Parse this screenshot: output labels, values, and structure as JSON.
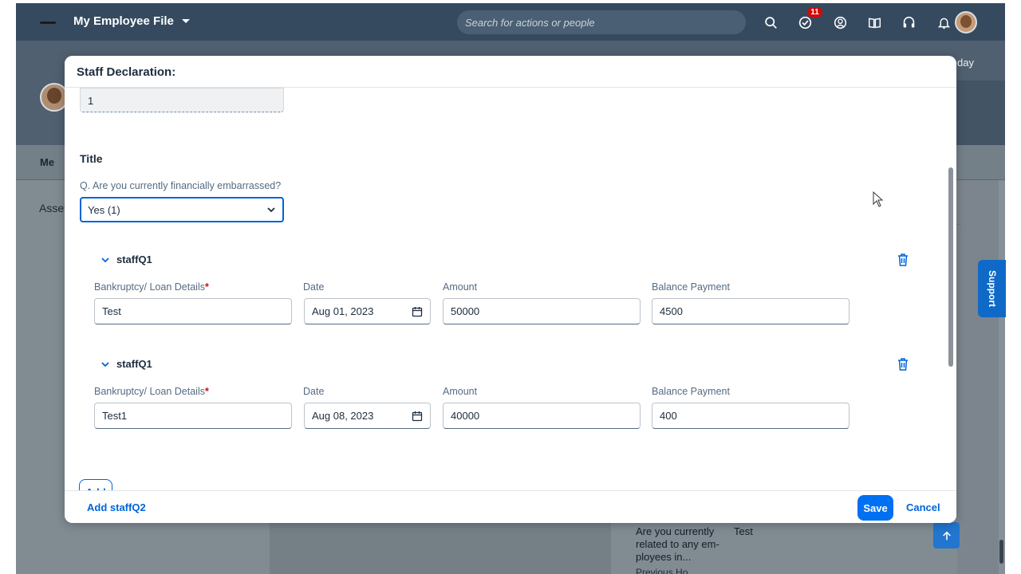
{
  "shell": {
    "title": "My Employee File",
    "search_placeholder": "Search for actions or people",
    "notification_count": "11",
    "icons": [
      "search-icon",
      "task-check-icon",
      "people-icon",
      "learning-book-icon",
      "headset-icon",
      "bell-icon"
    ]
  },
  "background": {
    "header_text": "day",
    "tab_me": "Me",
    "section_label": "Asset",
    "question": "Are you currently related to any em-ployees in...",
    "answer": "Test",
    "more": "Previous Ho...",
    "support_label": "Support"
  },
  "dialog": {
    "title": "Staff Declaration:",
    "top_field_value": "1",
    "section_title": "Title",
    "question": "Q. Are you currently financially embarrassed?",
    "selected_option": "Yes (1)",
    "groups": [
      {
        "name": "staffQ1",
        "labels": {
          "details": "Bankruptcy/ Loan Details",
          "date": "Date",
          "amount": "Amount",
          "balance": "Balance Payment"
        },
        "values": {
          "details": "Test",
          "date": "Aug 01, 2023",
          "amount": "50000",
          "balance": "4500"
        }
      },
      {
        "name": "staffQ1",
        "labels": {
          "details": "Bankruptcy/ Loan Details",
          "date": "Date",
          "amount": "Amount",
          "balance": "Balance Payment"
        },
        "values": {
          "details": "Test1",
          "date": "Aug 08, 2023",
          "amount": "40000",
          "balance": "400"
        }
      }
    ],
    "required_marker": "*",
    "add_label": "Add",
    "footer": {
      "add_staffq2": "Add staffQ2",
      "save": "Save",
      "cancel": "Cancel"
    }
  },
  "colors": {
    "shell": "#354a5f",
    "accent": "#0064d9",
    "primary_button": "#0070f2",
    "required": "#d20a0a",
    "badge": "#d20a0a"
  }
}
